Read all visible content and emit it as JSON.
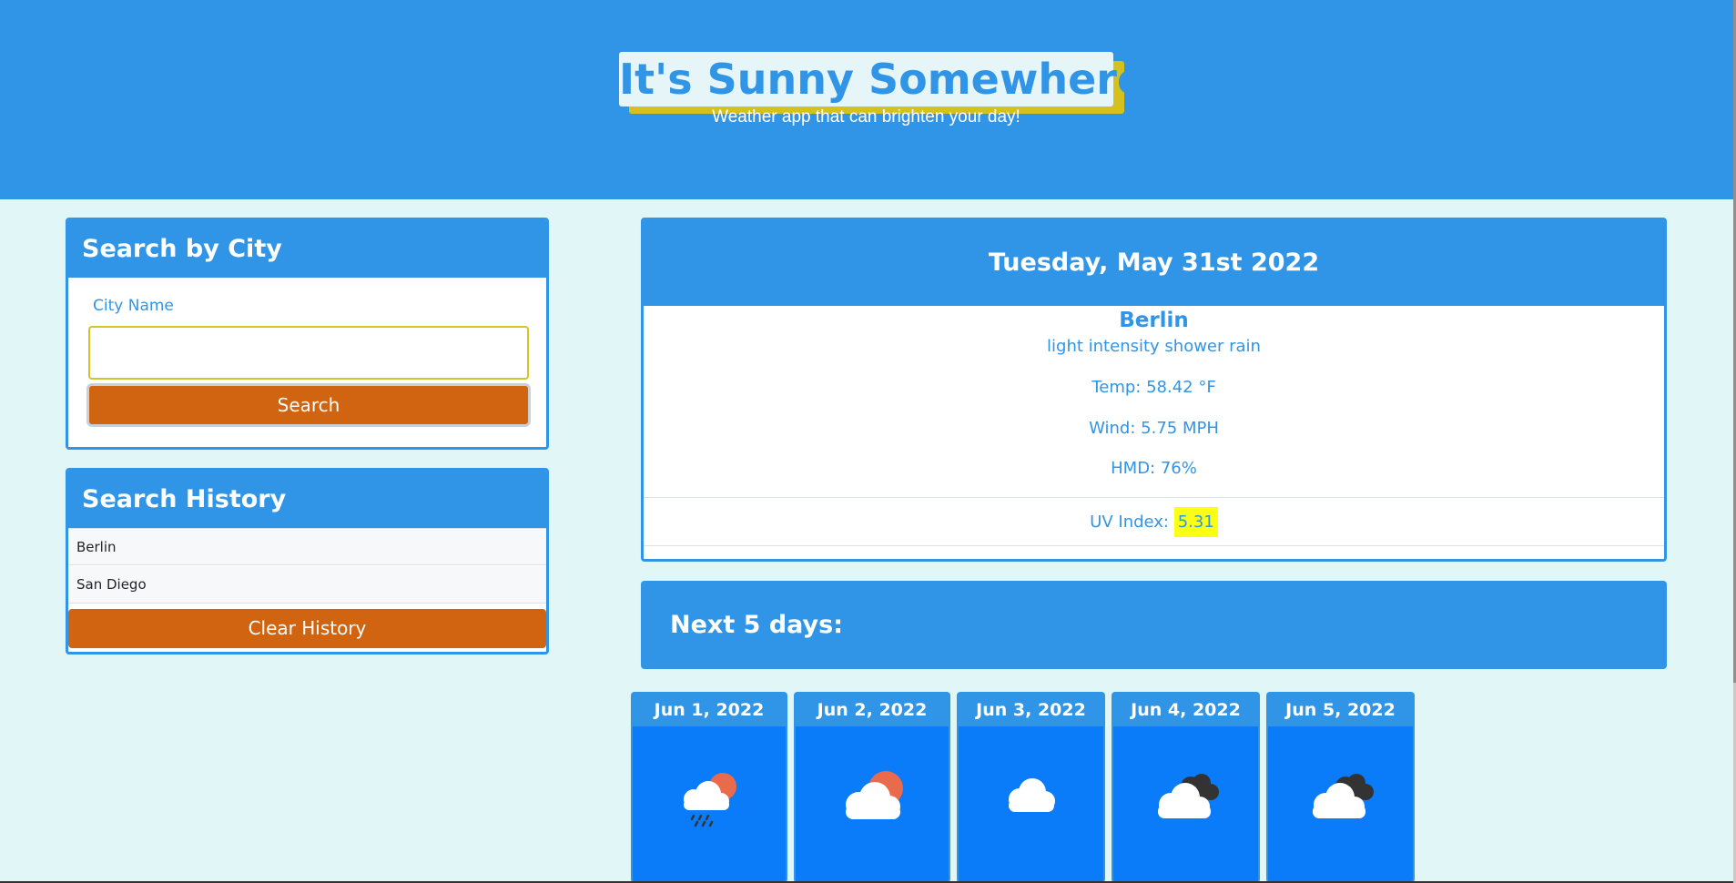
{
  "header": {
    "title": "It's Sunny Somewhere!",
    "subtitle": "Weather app that can brighten your day!"
  },
  "search": {
    "heading": "Search by City",
    "label": "City Name",
    "input_value": "",
    "button_label": "Search"
  },
  "history": {
    "heading": "Search History",
    "items": [
      "Berlin",
      "San Diego"
    ],
    "clear_label": "Clear History"
  },
  "current": {
    "date": "Tuesday, May 31st 2022",
    "city": "Berlin",
    "description": "light intensity shower rain",
    "temp": "Temp: 58.42 °F",
    "wind": "Wind: 5.75 MPH",
    "humidity": "HMD: 76%",
    "uv_label": "UV Index: ",
    "uv_value": "5.31"
  },
  "forecast": {
    "heading": "Next 5 days:",
    "days": [
      {
        "date": "Jun 1, 2022",
        "icon": "rain-cloud-sun-icon"
      },
      {
        "date": "Jun 2, 2022",
        "icon": "partly-sunny-icon"
      },
      {
        "date": "Jun 3, 2022",
        "icon": "cloud-icon"
      },
      {
        "date": "Jun 4, 2022",
        "icon": "broken-clouds-icon"
      },
      {
        "date": "Jun 5, 2022",
        "icon": "broken-clouds-icon"
      }
    ]
  },
  "colors": {
    "primary": "#3195e7",
    "accent": "#d16411",
    "background": "#e1f6f7",
    "title_shadow": "#d5c11e",
    "uv_highlight": "#fbff13",
    "forecast_card": "#0a7cfa"
  }
}
